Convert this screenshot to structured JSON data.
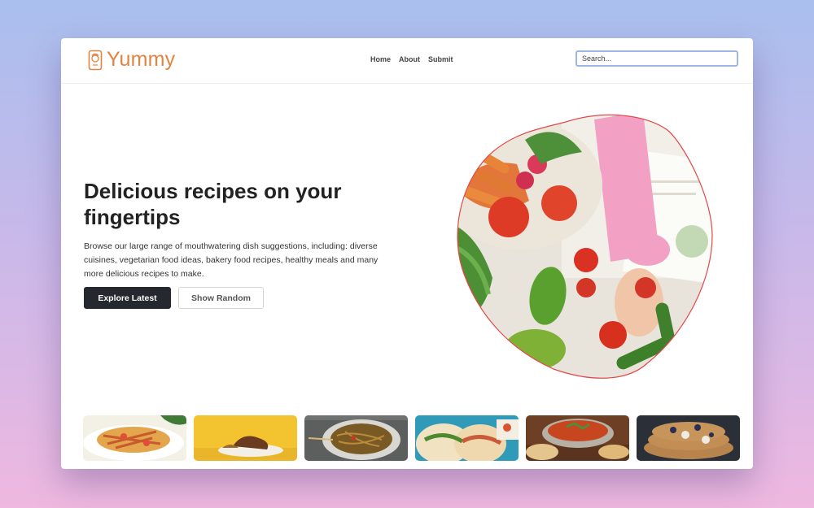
{
  "header": {
    "logo_text": "Yummy",
    "logo_icon": "chef-phone-icon",
    "brand_color": "#e2833f",
    "nav": [
      {
        "label": "Home"
      },
      {
        "label": "About"
      },
      {
        "label": "Submit"
      }
    ],
    "search": {
      "placeholder": "Search...",
      "value": ""
    }
  },
  "hero": {
    "title": "Delicious recipes on your fingertips",
    "description": "Browse our large range of mouthwatering dish suggestions, including: diverse cuisines, vegetarian food ideas, bakery food recipes, healthy meals and many more delicious recipes to make.",
    "primary_button": "Explore Latest",
    "secondary_button": "Show Random",
    "image": "vegetables-hands-photo"
  },
  "thumbnails": [
    {
      "name": "papaya-salad-photo"
    },
    {
      "name": "sandwich-yellow-photo"
    },
    {
      "name": "noodles-bowl-photo"
    },
    {
      "name": "tacos-photo"
    },
    {
      "name": "curry-bowl-photo"
    },
    {
      "name": "pancakes-photo"
    }
  ]
}
